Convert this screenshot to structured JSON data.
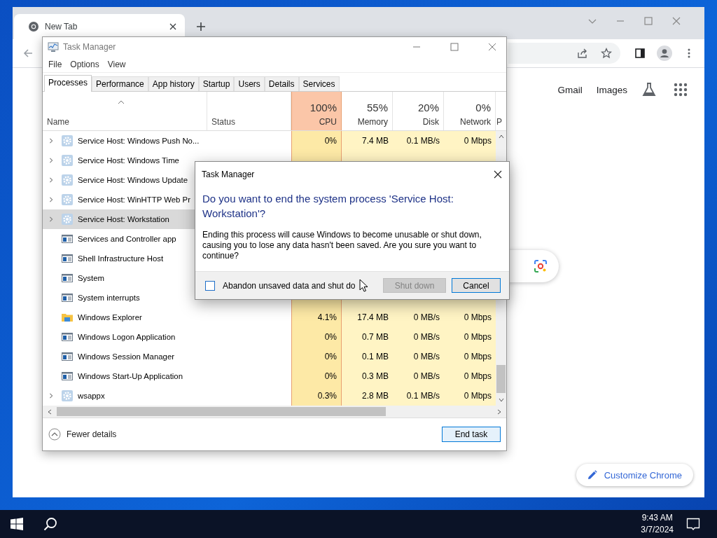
{
  "browser": {
    "tab": {
      "title": "New Tab"
    },
    "links": [
      "Gmail",
      "Images"
    ],
    "customize_button": "Customize Chrome"
  },
  "task_manager": {
    "title": "Task Manager",
    "menu": [
      "File",
      "Options",
      "View"
    ],
    "tabs": [
      {
        "label": "Processes",
        "selected": true
      },
      {
        "label": "Performance",
        "selected": false
      },
      {
        "label": "App history",
        "selected": false
      },
      {
        "label": "Startup",
        "selected": false
      },
      {
        "label": "Users",
        "selected": false
      },
      {
        "label": "Details",
        "selected": false
      },
      {
        "label": "Services",
        "selected": false
      }
    ],
    "columns": [
      {
        "kind": "text",
        "label": "Name",
        "sorted": true
      },
      {
        "kind": "text",
        "label": "Status"
      },
      {
        "kind": "metric",
        "reading": "100%",
        "label": "CPU",
        "highlighted": true
      },
      {
        "kind": "metric",
        "reading": "55%",
        "label": "Memory",
        "highlighted": false
      },
      {
        "kind": "metric",
        "reading": "20%",
        "label": "Disk",
        "highlighted": false
      },
      {
        "kind": "metric",
        "reading": "0%",
        "label": "Network",
        "highlighted": false
      },
      {
        "kind": "text",
        "label": "P"
      }
    ],
    "rows": [
      {
        "name": "Service Host: Windows Push No...",
        "kind": "service",
        "expandable": true,
        "selected": false,
        "cpu": "0%",
        "memory": "7.4 MB",
        "disk": "0.1 MB/s",
        "network": "0 Mbps"
      },
      {
        "name": "Service Host: Windows Time",
        "kind": "service",
        "expandable": true,
        "selected": false
      },
      {
        "name": "Service Host: Windows Update",
        "kind": "service",
        "expandable": true,
        "selected": false
      },
      {
        "name": "Service Host: WinHTTP Web Pr",
        "kind": "service",
        "expandable": true,
        "selected": false
      },
      {
        "name": "Service Host: Workstation",
        "kind": "service",
        "expandable": true,
        "selected": true
      },
      {
        "name": "Services and Controller app",
        "kind": "app",
        "expandable": false,
        "selected": false
      },
      {
        "name": "Shell Infrastructure Host",
        "kind": "app",
        "expandable": false,
        "selected": false
      },
      {
        "name": "System",
        "kind": "app",
        "expandable": false,
        "selected": false
      },
      {
        "name": "System interrupts",
        "kind": "app",
        "expandable": false,
        "selected": false
      },
      {
        "name": "Windows Explorer",
        "kind": "folder",
        "expandable": false,
        "selected": false,
        "cpu": "4.1%",
        "memory": "17.4 MB",
        "disk": "0 MB/s",
        "network": "0 Mbps"
      },
      {
        "name": "Windows Logon Application",
        "kind": "app",
        "expandable": false,
        "selected": false,
        "cpu": "0%",
        "memory": "0.7 MB",
        "disk": "0 MB/s",
        "network": "0 Mbps"
      },
      {
        "name": "Windows Session Manager",
        "kind": "app",
        "expandable": false,
        "selected": false,
        "cpu": "0%",
        "memory": "0.1 MB",
        "disk": "0 MB/s",
        "network": "0 Mbps"
      },
      {
        "name": "Windows Start-Up Application",
        "kind": "app",
        "expandable": false,
        "selected": false,
        "cpu": "0%",
        "memory": "0.3 MB",
        "disk": "0 MB/s",
        "network": "0 Mbps"
      },
      {
        "name": "wsappx",
        "kind": "service",
        "expandable": true,
        "selected": false,
        "cpu": "0.3%",
        "memory": "2.8 MB",
        "disk": "0.1 MB/s",
        "network": "0 Mbps"
      }
    ],
    "fewer_details": "Fewer details",
    "end_task": "End task"
  },
  "dialog": {
    "title": "Task Manager",
    "heading": "Do you want to end the system process 'Service Host: Workstation'?",
    "body": "Ending this process will cause Windows to become unusable or shut down, causing you to lose any data hasn't been saved. Are you sure you want to continue?",
    "checkbox": {
      "label": "Abandon unsaved data and shut do",
      "checked": false
    },
    "buttons": [
      {
        "label": "Shut down",
        "disabled": true
      },
      {
        "label": "Cancel",
        "disabled": false
      }
    ]
  },
  "taskbar": {
    "time": "9:43 AM",
    "date": "3/7/2024"
  }
}
